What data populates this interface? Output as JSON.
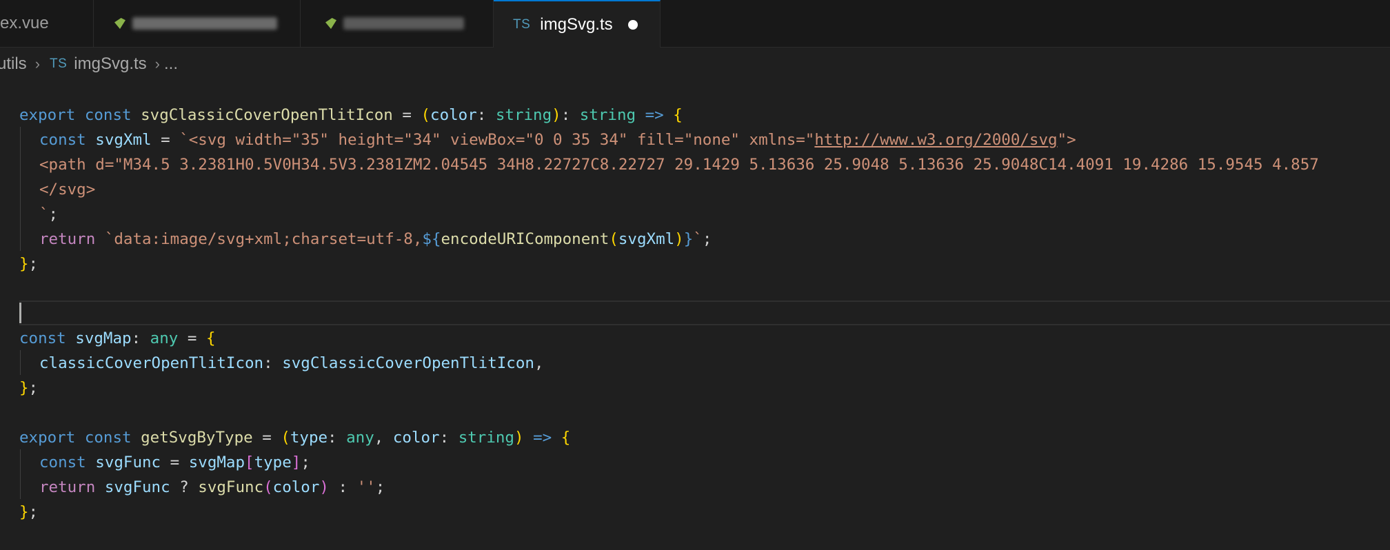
{
  "tabs": [
    {
      "label": "ex.vue",
      "active": false
    },
    {
      "label": "",
      "active": false,
      "obscured": true
    },
    {
      "label": "",
      "active": false,
      "obscured": true
    },
    {
      "label": "imgSvg.ts",
      "badge": "TS",
      "active": true,
      "unsaved": true
    }
  ],
  "breadcrumb": {
    "folder": "utils",
    "file_badge": "TS",
    "file": "imgSvg.ts",
    "tail": "..."
  },
  "code": {
    "l1": {
      "export": "export",
      "const": "const",
      "name": "svgClassicCoverOpenTlitIcon",
      "eq": " = ",
      "p1": "(",
      "param": "color",
      "colon": ": ",
      "type": "string",
      "p2": ")",
      "colon2": ": ",
      "rtype": "string",
      "arrow": " =>",
      "brace": "{"
    },
    "l2": {
      "const": "const",
      "name": "svgXml",
      "eq": " = ",
      "str": "`<svg width=\"35\" height=\"34\" viewBox=\"0 0 35 34\" fill=\"none\" xmlns=\"",
      "url": "http://www.w3.org/2000/svg",
      "end": "\">"
    },
    "l3": {
      "str": "<path d=\"M34.5 3.2381H0.5V0H34.5V3.2381ZM2.04545 34H8.22727C8.22727 29.1429 5.13636 25.9048 5.13636 25.9048C14.4091 19.4286 15.9545 4.857"
    },
    "l4": {
      "str": "</svg>"
    },
    "l5": {
      "str": "`",
      "semi": ";"
    },
    "l6": {
      "ret": "return",
      "str1": "`data:image/svg+xml;charset=utf-8,",
      "tpl": "${",
      "fn": "encodeURIComponent",
      "po": "(",
      "arg": "svgXml",
      "pc": ")",
      "tplc": "}",
      "str2": "`",
      "semi": ";"
    },
    "l7": {
      "brace": "}",
      "semi": ";"
    },
    "l9": {
      "const": "const",
      "name": "svgMap",
      "colon": ": ",
      "type": "any",
      "eq": " = ",
      "brace": "{"
    },
    "l10": {
      "key": "classicCoverOpenTlitIcon",
      "colon": ": ",
      "val": "svgClassicCoverOpenTlitIcon",
      "comma": ","
    },
    "l11": {
      "brace": "}",
      "semi": ";"
    },
    "l13": {
      "export": "export",
      "const": "const",
      "name": "getSvgByType",
      "eq": " = ",
      "p1": "(",
      "param1": "type",
      "c1": ": ",
      "t1": "any",
      "comma": ", ",
      "param2": "color",
      "c2": ": ",
      "t2": "string",
      "p2": ")",
      "arrow": " =>",
      "brace": "{"
    },
    "l14": {
      "const": "const",
      "name": "svgFunc",
      "eq": " = ",
      "obj": "svgMap",
      "bo": "[",
      "key": "type",
      "bc": "]",
      "semi": ";"
    },
    "l15": {
      "ret": "return",
      "v": "svgFunc",
      "q": " ? ",
      "fn": "svgFunc",
      "po": "(",
      "arg": "color",
      "pc": ")",
      "c": " : ",
      "str": "''",
      "semi": ";"
    },
    "l16": {
      "brace": "}",
      "semi": ";"
    }
  },
  "colors": {
    "keyword": "#569cd6",
    "function": "#dcdcaa",
    "variable": "#9cdcfe",
    "type": "#4ec9b0",
    "string": "#ce9178",
    "control": "#c586c0",
    "bracket1": "#ffd700",
    "bracket2": "#da70d6",
    "bracket3": "#179fff",
    "ts_badge": "#519aba",
    "active_tab_accent": "#0078d4"
  }
}
